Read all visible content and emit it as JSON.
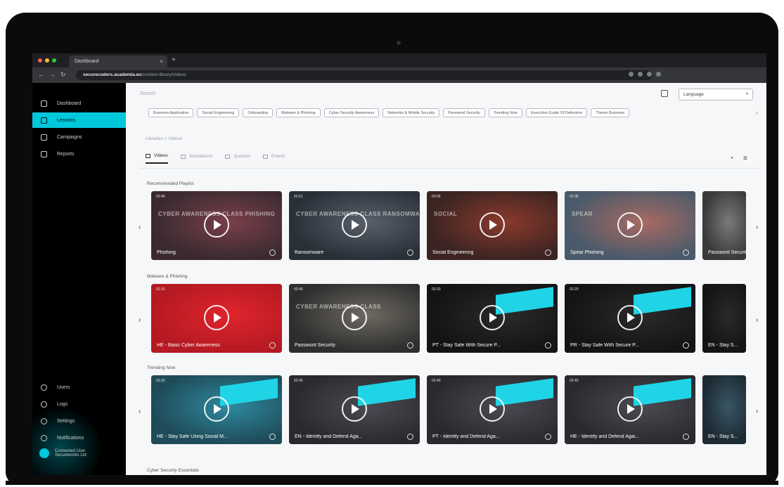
{
  "browser": {
    "tab_title": "Dashboard",
    "url_host": "securecoders.academia.eu",
    "url_path": "/content-library/videos",
    "traffic_colors": [
      "#ff5f57",
      "#febc2e",
      "#28c840"
    ]
  },
  "sidebar": {
    "items": [
      {
        "label": "Dashboard",
        "icon": "dashboard-icon",
        "active": false
      },
      {
        "label": "Lessons",
        "icon": "lessons-icon",
        "active": true
      },
      {
        "label": "Campaigns",
        "icon": "campaigns-icon",
        "active": false
      },
      {
        "label": "Reports",
        "icon": "reports-icon",
        "active": false
      }
    ],
    "bottom_items": [
      {
        "label": "Users",
        "icon": "users-icon"
      },
      {
        "label": "Logs",
        "icon": "logs-icon"
      },
      {
        "label": "Settings",
        "icon": "settings-icon"
      },
      {
        "label": "Notifications",
        "icon": "notifications-icon"
      }
    ],
    "account": {
      "line1": "Connected User",
      "line2": "Secureworks Ltd"
    }
  },
  "header": {
    "search_placeholder": "Search",
    "language_label": "Language"
  },
  "chips": [
    "Business Application",
    "Social Engineering",
    "Onboarding",
    "Malware & Phishing",
    "Cyber Security Awareness",
    "Networks & Mobile Security",
    "Password Security",
    "Trending Now",
    "Executive Guide Of Defensive",
    "Theme Business"
  ],
  "breadcrumb": "Libraries  >  Videos",
  "tabs": [
    {
      "label": "Videos",
      "active": true
    },
    {
      "label": "Simulations",
      "active": false
    },
    {
      "label": "Quizzes",
      "active": false
    },
    {
      "label": "Events",
      "active": false
    }
  ],
  "sections": [
    {
      "title": "Recommended Playlist",
      "cards": [
        {
          "title": "Phishing",
          "duration": "02:46",
          "overlay": "CYBER AWARENESS CLASS PHISHING",
          "bg": "#3a2a30",
          "accent": "#7a3f4a",
          "banner": false
        },
        {
          "title": "Ransomware",
          "duration": "02:51",
          "overlay": "CYBER AWARENESS CLASS RANSOMWARE",
          "bg": "#2a3038",
          "accent": "#59606b",
          "banner": false
        },
        {
          "title": "Social Engineering",
          "duration": "03:05",
          "overlay": "SOCIAL",
          "bg": "#3b2422",
          "accent": "#8a3a2c",
          "banner": false
        },
        {
          "title": "Spear Phishing",
          "duration": "02:38",
          "overlay": "SPEAR",
          "bg": "#4a5a6a",
          "accent": "#a86a62",
          "banner": false
        },
        {
          "title": "Password Security",
          "duration": "",
          "overlay": "",
          "bg": "#3a3a3a",
          "accent": "#7a7a7a",
          "banner": false
        }
      ]
    },
    {
      "title": "Malware & Phishing",
      "cards": [
        {
          "title": "HE - Basic Cyber Awareness",
          "duration": "02:15",
          "overlay": "",
          "bg": "#b51a22",
          "accent": "#e0242c",
          "banner": false
        },
        {
          "title": "Password Security",
          "duration": "02:49",
          "overlay": "CYBER AWARENESS CLASS",
          "bg": "#2e2e2e",
          "accent": "#6e6a62",
          "banner": false
        },
        {
          "title": "PT - Stay Safe With Secure P...",
          "duration": "02:20",
          "overlay": "",
          "bg": "#141414",
          "accent": "#2a2a2a",
          "banner": true
        },
        {
          "title": "PR - Stay Safe With Secure P...",
          "duration": "02:20",
          "overlay": "",
          "bg": "#141414",
          "accent": "#2a2a2a",
          "banner": true
        },
        {
          "title": "EN - Stay S...",
          "duration": "",
          "overlay": "",
          "bg": "#141414",
          "accent": "#2a2a2a",
          "banner": false
        }
      ]
    },
    {
      "title": "Trending Now",
      "cards": [
        {
          "title": "HE - Stay Safe Using Social M...",
          "duration": "02:33",
          "overlay": "",
          "bg": "#1f4b58",
          "accent": "#2e8aa0",
          "banner": true
        },
        {
          "title": "EN - Identify and Defend Aga...",
          "duration": "02:40",
          "overlay": "",
          "bg": "#2a2a2e",
          "accent": "#4a4a52",
          "banner": true
        },
        {
          "title": "PT - Identify and Defend Aga...",
          "duration": "02:40",
          "overlay": "",
          "bg": "#2a2a2e",
          "accent": "#4a4a52",
          "banner": true
        },
        {
          "title": "HE - Identify and Defend Agai...",
          "duration": "02:40",
          "overlay": "",
          "bg": "#2a2a2e",
          "accent": "#4a4a52",
          "banner": true
        },
        {
          "title": "EN - Stay S...",
          "duration": "",
          "overlay": "",
          "bg": "#1c2a33",
          "accent": "#3a5664",
          "banner": false
        }
      ]
    }
  ],
  "next_section_title": "Cyber Security Essentials"
}
